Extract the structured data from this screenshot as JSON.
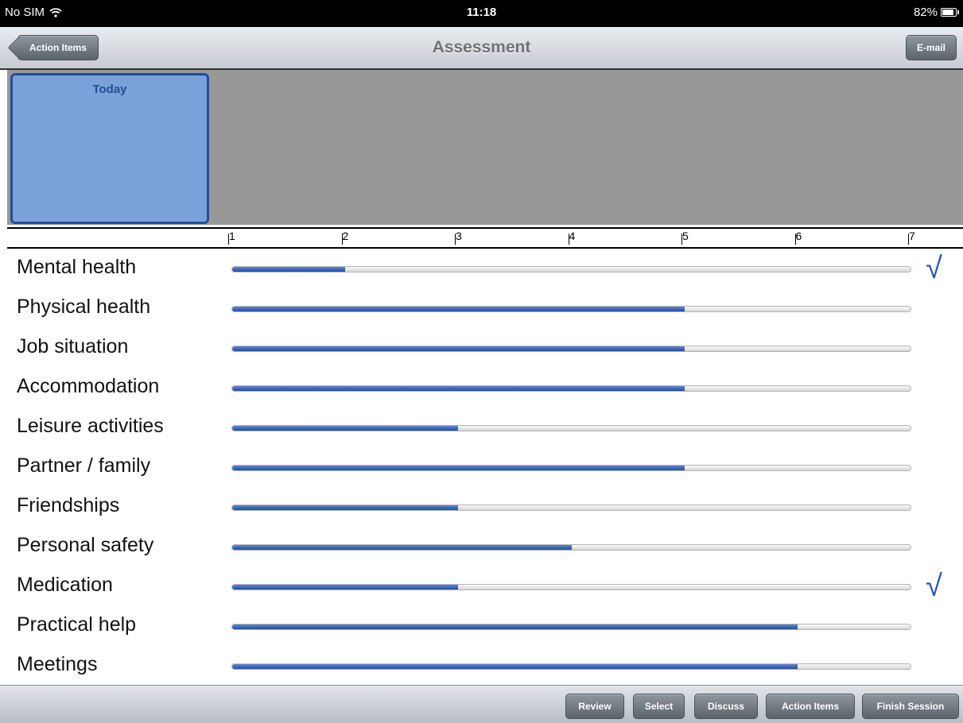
{
  "status_bar": {
    "carrier": "No SIM",
    "time": "11:18",
    "battery": "82%"
  },
  "nav": {
    "back_label": "Action Items",
    "title": "Assessment",
    "email_label": "E-mail"
  },
  "panel": {
    "today_label": "Today"
  },
  "scale": {
    "ticks": [
      "1",
      "2",
      "3",
      "4",
      "5",
      "6",
      "7"
    ]
  },
  "rows": [
    {
      "label": "Mental health",
      "value": 2,
      "checked": true
    },
    {
      "label": "Physical health",
      "value": 5,
      "checked": false
    },
    {
      "label": "Job situation",
      "value": 5,
      "checked": false
    },
    {
      "label": "Accommodation",
      "value": 5,
      "checked": false
    },
    {
      "label": "Leisure activities",
      "value": 3,
      "checked": false
    },
    {
      "label": "Partner / family",
      "value": 5,
      "checked": false
    },
    {
      "label": "Friendships",
      "value": 3,
      "checked": false
    },
    {
      "label": "Personal safety",
      "value": 4,
      "checked": false
    },
    {
      "label": "Medication",
      "value": 3,
      "checked": true
    },
    {
      "label": "Practical help",
      "value": 6,
      "checked": false
    },
    {
      "label": "Meetings",
      "value": 6,
      "checked": false
    }
  ],
  "check_glyph": "√",
  "toolbar": {
    "buttons": [
      {
        "label": "Review"
      },
      {
        "label": "Select"
      },
      {
        "label": "Discuss"
      },
      {
        "label": "Action Items"
      },
      {
        "label": "Finish Session"
      }
    ]
  },
  "colors": {
    "accent": "#2654b5",
    "panel": "#989898",
    "today_fill": "#7ba2d8"
  }
}
